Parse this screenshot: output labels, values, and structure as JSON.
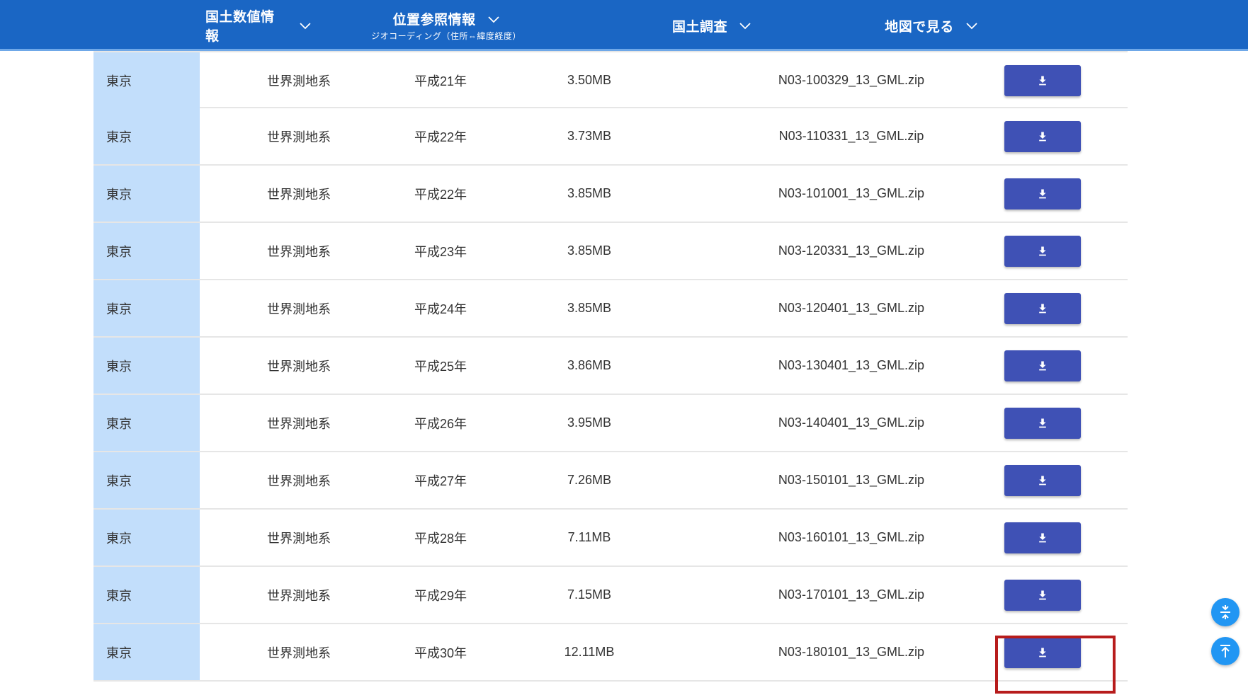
{
  "nav": {
    "items": [
      {
        "label": "国土数値情報",
        "sub": ""
      },
      {
        "label": "位置参照情報",
        "sub": "ジオコーディング（住所⇔緯度経度）"
      },
      {
        "label": "国土調査",
        "sub": ""
      },
      {
        "label": "地図で見る",
        "sub": ""
      }
    ]
  },
  "table": {
    "rows": [
      {
        "pref": "東京",
        "datum": "世界測地系",
        "year": "平成21年",
        "size": "3.50MB",
        "file": "N03-100329_13_GML.zip"
      },
      {
        "pref": "東京",
        "datum": "世界測地系",
        "year": "平成22年",
        "size": "3.73MB",
        "file": "N03-110331_13_GML.zip"
      },
      {
        "pref": "東京",
        "datum": "世界測地系",
        "year": "平成22年",
        "size": "3.85MB",
        "file": "N03-101001_13_GML.zip"
      },
      {
        "pref": "東京",
        "datum": "世界測地系",
        "year": "平成23年",
        "size": "3.85MB",
        "file": "N03-120331_13_GML.zip"
      },
      {
        "pref": "東京",
        "datum": "世界測地系",
        "year": "平成24年",
        "size": "3.85MB",
        "file": "N03-120401_13_GML.zip"
      },
      {
        "pref": "東京",
        "datum": "世界測地系",
        "year": "平成25年",
        "size": "3.86MB",
        "file": "N03-130401_13_GML.zip"
      },
      {
        "pref": "東京",
        "datum": "世界測地系",
        "year": "平成26年",
        "size": "3.95MB",
        "file": "N03-140401_13_GML.zip"
      },
      {
        "pref": "東京",
        "datum": "世界測地系",
        "year": "平成27年",
        "size": "7.26MB",
        "file": "N03-150101_13_GML.zip"
      },
      {
        "pref": "東京",
        "datum": "世界測地系",
        "year": "平成28年",
        "size": "7.11MB",
        "file": "N03-160101_13_GML.zip"
      },
      {
        "pref": "東京",
        "datum": "世界測地系",
        "year": "平成29年",
        "size": "7.15MB",
        "file": "N03-170101_13_GML.zip"
      },
      {
        "pref": "東京",
        "datum": "世界測地系",
        "year": "平成30年",
        "size": "12.11MB",
        "file": "N03-180101_13_GML.zip"
      }
    ]
  },
  "icons": {
    "download": "download-icon",
    "collapse": "collapse-icon",
    "scroll_top": "scroll-to-top-icon",
    "nav_dropdown": "chevron-down-icon"
  },
  "colors": {
    "header": "#1a66c4",
    "pref_cell": "#c2defb",
    "download_button": "#3f51b5",
    "fab": "#2196f3",
    "highlight": "#b71c1c"
  }
}
